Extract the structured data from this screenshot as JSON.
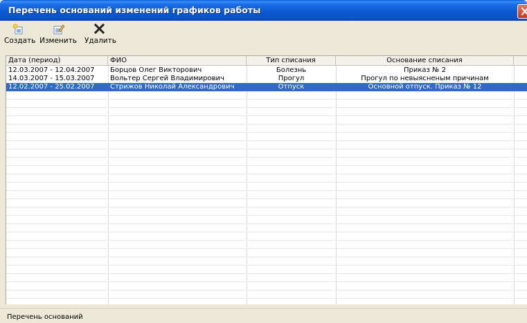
{
  "window": {
    "title": "Перечень оснований изменений графиков работы"
  },
  "toolbar": {
    "buttons": [
      {
        "label": "Создать",
        "icon": "new-document-icon"
      },
      {
        "label": "Изменить",
        "icon": "edit-document-icon"
      },
      {
        "label": "Удалить",
        "icon": "delete-x-icon"
      }
    ]
  },
  "table": {
    "columns": [
      "Дата (период)",
      "ФИО",
      "Тип списания",
      "Основание списания"
    ],
    "rows": [
      {
        "period": "12.03.2007 - 12.04.2007",
        "name": "Борцов Олег Викторович",
        "type": "Болезнь",
        "reason": "Приказ № 2",
        "selected": false
      },
      {
        "period": "14.03.2007 - 15.03.2007",
        "name": "Вольтер Сергей Владимирович",
        "type": "Прогул",
        "reason": "Прогул по невыясненым причинам",
        "selected": false
      },
      {
        "period": "12.02.2007 - 25.02.2007",
        "name": "Стрижов Николай Александрович",
        "type": "Отпуск",
        "reason": "Основной отпуск. Приказ № 12",
        "selected": true
      }
    ]
  },
  "status": {
    "text": "Перечень оснований"
  },
  "colors": {
    "selection": "#316ac5",
    "titlebar": "#0a58d0",
    "window_bg": "#ece9d8"
  }
}
